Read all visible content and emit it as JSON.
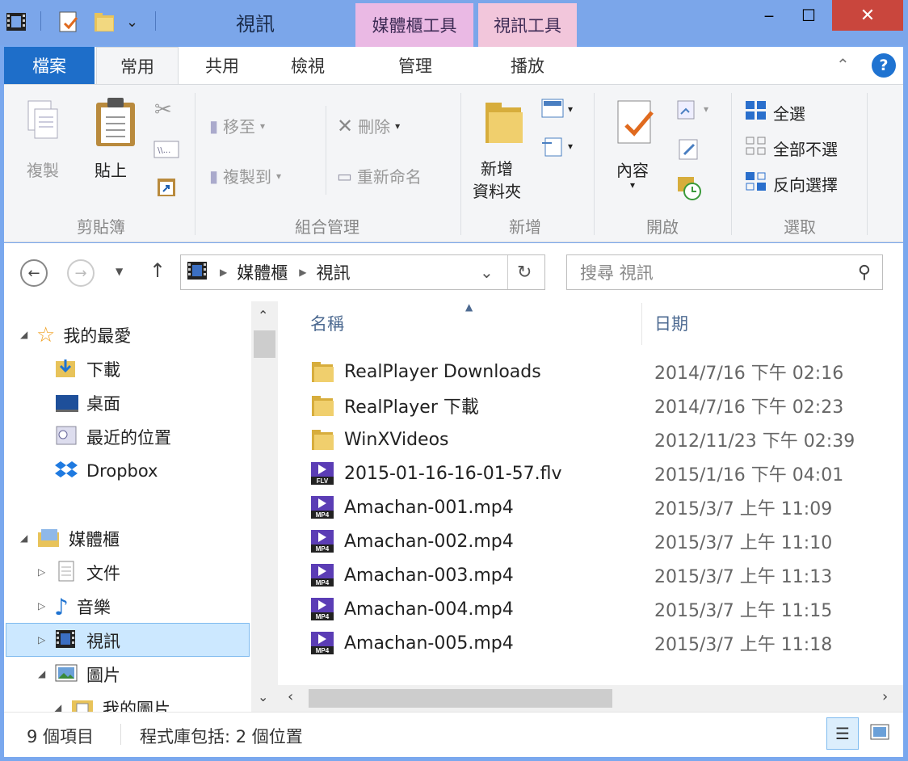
{
  "window": {
    "title": "視訊",
    "context_tabs": [
      "媒體櫃工具",
      "視訊工具"
    ],
    "controls": {
      "minimize": "‒",
      "maximize": "☐",
      "close": "✕"
    }
  },
  "tabs": {
    "file": "檔案",
    "home": "常用",
    "share": "共用",
    "view": "檢視",
    "manage": "管理",
    "play": "播放"
  },
  "ribbon": {
    "clipboard": {
      "copy": "複製",
      "paste": "貼上",
      "label": "剪貼簿"
    },
    "organize": {
      "move_to": "移至",
      "copy_to": "複製到",
      "delete": "刪除",
      "rename": "重新命名",
      "label": "組合管理"
    },
    "new": {
      "new_folder_line1": "新增",
      "new_folder_line2": "資料夾",
      "label": "新增"
    },
    "open": {
      "properties": "內容",
      "label": "開啟"
    },
    "select": {
      "select_all": "全選",
      "select_none": "全部不選",
      "invert": "反向選擇",
      "label": "選取"
    }
  },
  "address": {
    "crumbs": [
      "媒體櫃",
      "視訊"
    ],
    "search_placeholder": "搜尋 視訊"
  },
  "nav": {
    "favorites": "我的最愛",
    "fav_items": [
      "下載",
      "桌面",
      "最近的位置",
      "Dropbox"
    ],
    "libraries": "媒體櫃",
    "lib_items": [
      "文件",
      "音樂",
      "視訊",
      "圖片"
    ],
    "sub_pictures": "我的圖片"
  },
  "content": {
    "col_name": "名稱",
    "col_date": "日期",
    "files": [
      {
        "name": "RealPlayer Downloads",
        "date": "2014/7/16 下午 02:16",
        "type": "folder"
      },
      {
        "name": "RealPlayer 下載",
        "date": "2014/7/16 下午 02:23",
        "type": "folder"
      },
      {
        "name": "WinXVideos",
        "date": "2012/11/23 下午 02:39",
        "type": "folder"
      },
      {
        "name": "2015-01-16-16-01-57.flv",
        "date": "2015/1/16 下午 04:01",
        "type": "FLV"
      },
      {
        "name": "Amachan-001.mp4",
        "date": "2015/3/7 上午 11:09",
        "type": "MP4"
      },
      {
        "name": "Amachan-002.mp4",
        "date": "2015/3/7 上午 11:10",
        "type": "MP4"
      },
      {
        "name": "Amachan-003.mp4",
        "date": "2015/3/7 上午 11:13",
        "type": "MP4"
      },
      {
        "name": "Amachan-004.mp4",
        "date": "2015/3/7 上午 11:15",
        "type": "MP4"
      },
      {
        "name": "Amachan-005.mp4",
        "date": "2015/3/7 上午 11:18",
        "type": "MP4"
      }
    ]
  },
  "status": {
    "count": "9 個項目",
    "library": "程式庫包括: 2 個位置"
  }
}
